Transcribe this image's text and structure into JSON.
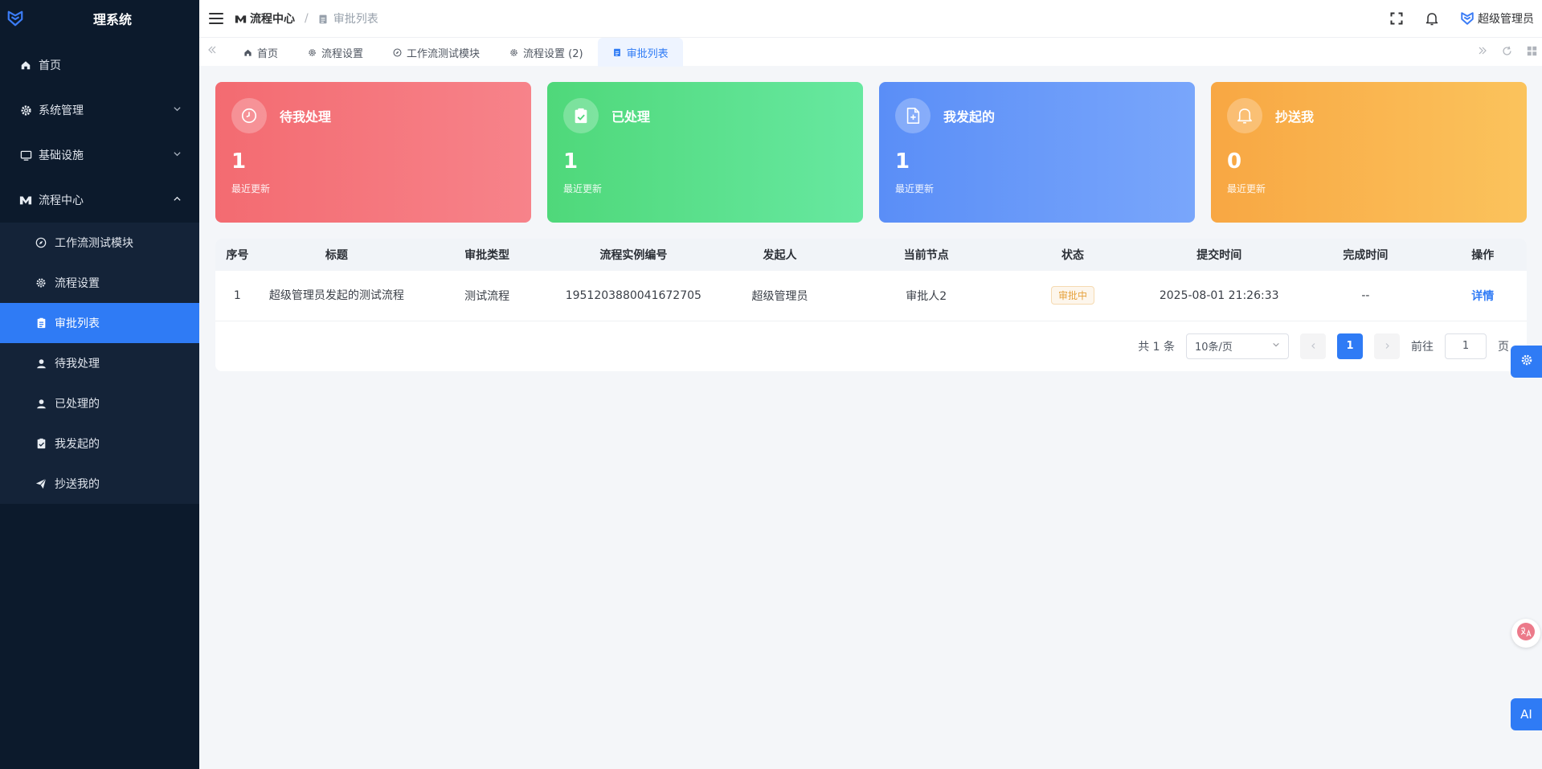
{
  "app": {
    "title": "理系统",
    "brand_color": "#2f7bf5"
  },
  "sidebar": {
    "items": [
      {
        "label": "首页",
        "icon": "home-icon"
      },
      {
        "label": "系统管理",
        "icon": "gear-icon"
      },
      {
        "label": "基础设施",
        "icon": "monitor-icon"
      },
      {
        "label": "流程中心",
        "icon": "flow-icon"
      }
    ],
    "sub_items": [
      {
        "label": "工作流测试模块",
        "icon": "compass-icon"
      },
      {
        "label": "流程设置",
        "icon": "settings-icon"
      },
      {
        "label": "审批列表",
        "icon": "list-icon",
        "active": true
      },
      {
        "label": "待我处理",
        "icon": "user-icon"
      },
      {
        "label": "已处理的",
        "icon": "user-check-icon"
      },
      {
        "label": "我发起的",
        "icon": "clipboard-icon"
      },
      {
        "label": "抄送我的",
        "icon": "send-icon"
      }
    ]
  },
  "header": {
    "breadcrumb_root": "流程中心",
    "breadcrumb_current": "审批列表",
    "user_name": "超级管理员"
  },
  "tabs": [
    {
      "label": "首页",
      "icon": "home-icon"
    },
    {
      "label": "流程设置",
      "icon": "gear-icon"
    },
    {
      "label": "工作流测试模块",
      "icon": "compass-icon"
    },
    {
      "label": "流程设置 (2)",
      "icon": "gear-icon"
    },
    {
      "label": "审批列表",
      "icon": "list-icon",
      "active": true
    }
  ],
  "cards": [
    {
      "title": "待我处理",
      "value": "1",
      "sub": "最近更新",
      "color": "#f36b71",
      "icon": "clock-icon"
    },
    {
      "title": "已处理",
      "value": "1",
      "sub": "最近更新",
      "color": "#4fd87a",
      "icon": "clipboard-check-icon"
    },
    {
      "title": "我发起的",
      "value": "1",
      "sub": "最近更新",
      "color": "#5a8ef7",
      "icon": "file-plus-icon"
    },
    {
      "title": "抄送我",
      "value": "0",
      "sub": "最近更新",
      "color": "#f8a743",
      "icon": "bell-icon"
    }
  ],
  "table": {
    "columns": [
      "序号",
      "标题",
      "审批类型",
      "流程实例编号",
      "发起人",
      "当前节点",
      "状态",
      "提交时间",
      "完成时间",
      "操作"
    ],
    "rows": [
      {
        "index": "1",
        "title": "超级管理员发起的测试流程",
        "type": "测试流程",
        "instance_id": "1951203880041672705",
        "initiator": "超级管理员",
        "node": "审批人2",
        "status": "审批中",
        "submit_time": "2025-08-01 21:26:33",
        "finish_time": "--",
        "action": "详情"
      }
    ]
  },
  "pagination": {
    "total": "共 1 条",
    "page_size": "10条/页",
    "current_page": "1",
    "goto_label": "前往",
    "goto_value": "1",
    "goto_suffix": "页"
  },
  "float": {
    "ai_label": "AI"
  }
}
